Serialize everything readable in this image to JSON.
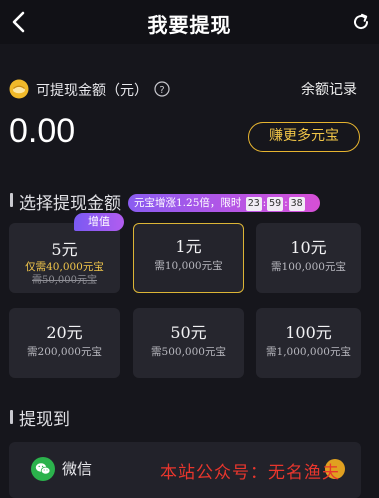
{
  "header": {
    "title": "我要提现",
    "back_icon": "chevron-left-icon",
    "refresh_icon": "refresh-icon"
  },
  "balance": {
    "label": "可提现金额（元）",
    "value": "0.00",
    "history_link": "余额记录",
    "earn_button": "赚更多元宝",
    "accent_color": "#e6b430"
  },
  "select_section": {
    "title": "选择提现金额",
    "promo_banner": {
      "text": "元宝增涨1.25倍，限时",
      "hours": "23",
      "minutes": "59",
      "seconds": "38"
    },
    "badge": "增值",
    "options": [
      {
        "amount": "5元",
        "requirement": "仅需40,000元宝",
        "original": "需50,000元宝"
      },
      {
        "amount": "1元",
        "requirement": "需10,000元宝"
      },
      {
        "amount": "10元",
        "requirement": "需100,000元宝"
      },
      {
        "amount": "20元",
        "requirement": "需200,000元宝"
      },
      {
        "amount": "50元",
        "requirement": "需500,000元宝"
      },
      {
        "amount": "100元",
        "requirement": "需1,000,000元宝"
      }
    ]
  },
  "withdraw_to": {
    "title": "提现到",
    "methods": [
      {
        "label": "微信",
        "icon": "wechat-icon"
      }
    ]
  },
  "watermark": "本站公众号：无名渔夫"
}
